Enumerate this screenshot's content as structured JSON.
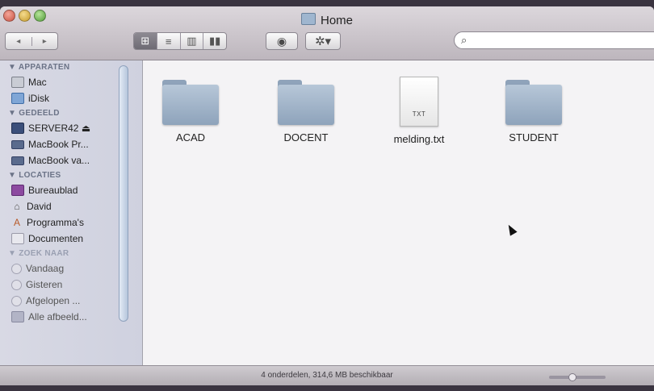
{
  "window": {
    "title": "Home"
  },
  "toolbar": {
    "back_icon": "◂",
    "forward_icon": "▸",
    "views": [
      "⊞",
      "≡",
      "▥",
      "▮▮"
    ],
    "quicklook_icon": "◉",
    "action_icon": "✲▾",
    "search_icon": "⌕",
    "search_value": ""
  },
  "sidebar": {
    "sections": [
      {
        "title": "▼ APPARATEN",
        "items": [
          {
            "label": "Mac",
            "icon": "mac"
          },
          {
            "label": "iDisk",
            "icon": "disk"
          }
        ]
      },
      {
        "title": "▼ GEDEELD",
        "items": [
          {
            "label": "SERVER42  ⏏",
            "icon": "server"
          },
          {
            "label": "MacBook Pr...",
            "icon": "laptop"
          },
          {
            "label": "MacBook va...",
            "icon": "laptop"
          }
        ]
      },
      {
        "title": "▼ LOCATIES",
        "items": [
          {
            "label": "Bureaublad",
            "icon": "desk"
          },
          {
            "label": "David",
            "icon": "home"
          },
          {
            "label": "Programma's",
            "icon": "apps"
          },
          {
            "label": "Documenten",
            "icon": "doc"
          }
        ]
      },
      {
        "title": "▼ ZOEK NAAR",
        "items": [
          {
            "label": "Vandaag",
            "icon": "clock"
          },
          {
            "label": "Gisteren",
            "icon": "clock"
          },
          {
            "label": "Afgelopen ...",
            "icon": "clock"
          },
          {
            "label": "Alle afbeeld...",
            "icon": "img"
          }
        ]
      }
    ]
  },
  "files": [
    {
      "name": "ACAD",
      "kind": "folder"
    },
    {
      "name": "DOCENT",
      "kind": "folder"
    },
    {
      "name": "melding.txt",
      "kind": "txt",
      "badge": "TXT"
    },
    {
      "name": "STUDENT",
      "kind": "folder"
    }
  ],
  "status": {
    "text": "4 onderdelen, 314,6 MB beschikbaar"
  }
}
